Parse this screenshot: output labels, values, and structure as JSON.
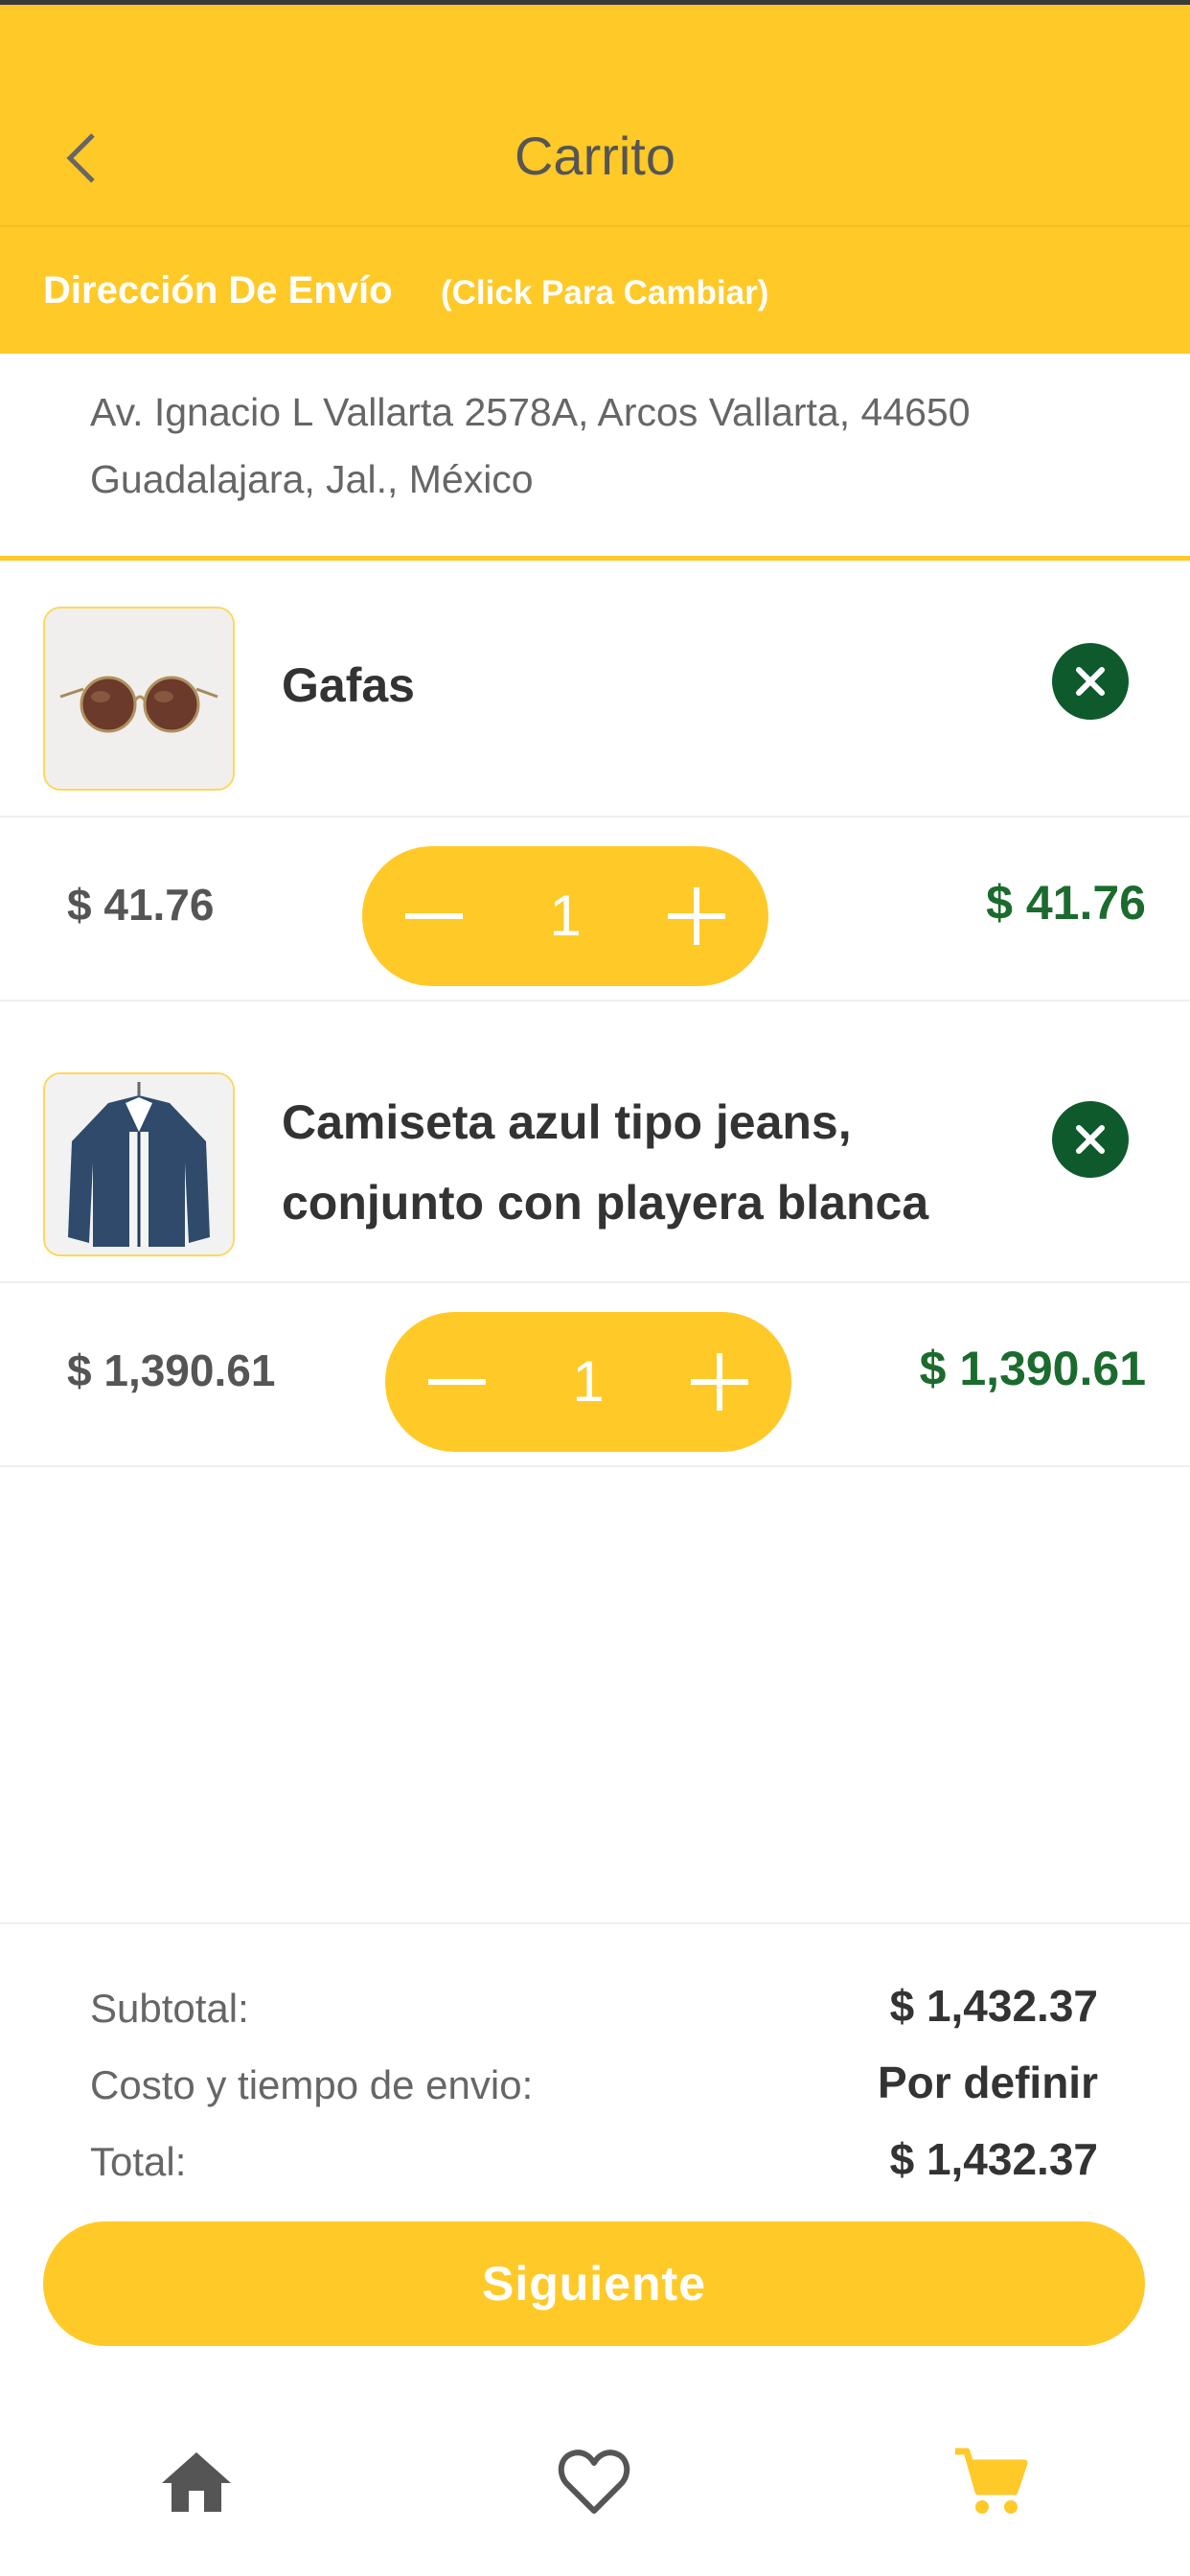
{
  "header": {
    "title": "Carrito"
  },
  "shipping": {
    "label": "Dirección De Envío",
    "hint": "(Click Para Cambiar)",
    "address_line1": "Av. Ignacio L Vallarta 2578A, Arcos Vallarta, 44650",
    "address_line2": "Guadalajara, Jal., México"
  },
  "cart": {
    "items": [
      {
        "name": "Gafas",
        "unit_price": "$ 41.76",
        "quantity": "1",
        "line_total": "$ 41.76",
        "image": "sunglasses"
      },
      {
        "name_line1": "Camiseta azul tipo jeans,",
        "name_line2": "conjunto con playera blanca",
        "unit_price": "$ 1,390.61",
        "quantity": "1",
        "line_total": "$ 1,390.61",
        "image": "denim-shirt"
      }
    ]
  },
  "summary": {
    "subtotal_label": "Subtotal:",
    "subtotal_value": "$ 1,432.37",
    "shipping_label": "Costo y tiempo de envio:",
    "shipping_value": "Por definir",
    "total_label": "Total:",
    "total_value": "$ 1,432.37"
  },
  "actions": {
    "next_label": "Siguiente"
  },
  "bottom_nav": {
    "items": [
      "home-icon",
      "heart-icon",
      "cart-icon"
    ],
    "active": "cart-icon"
  },
  "colors": {
    "accent": "#FFC928",
    "price_green": "#1C6B2E",
    "remove_green": "#0F5A2C"
  }
}
